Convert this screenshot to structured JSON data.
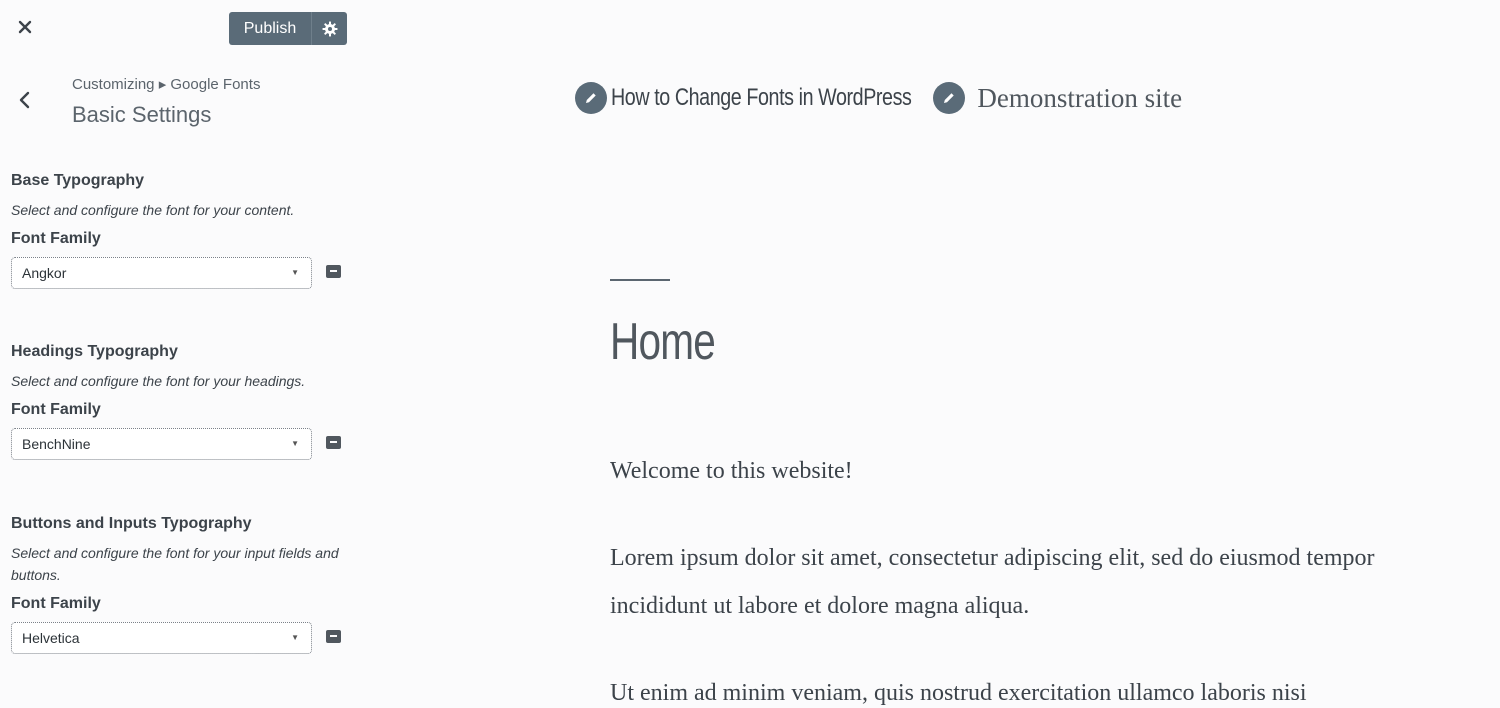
{
  "topbar": {
    "publish_label": "Publish"
  },
  "panel": {
    "breadcrumb": "Customizing ▸ Google Fonts",
    "title": "Basic Settings"
  },
  "sections": [
    {
      "title": "Base Typography",
      "description": "Select and configure the font for your content.",
      "font_family_label": "Font Family",
      "selected_font": "Angkor"
    },
    {
      "title": "Headings Typography",
      "description": "Select and configure the font for your headings.",
      "font_family_label": "Font Family",
      "selected_font": "BenchNine"
    },
    {
      "title": "Buttons and Inputs Typography",
      "description": "Select and configure the font for your input fields and buttons.",
      "font_family_label": "Font Family",
      "selected_font": "Helvetica"
    }
  ],
  "preview": {
    "site_title": "How to Change Fonts in WordPress",
    "site_description": "Demonstration site",
    "page_heading": "Home",
    "paragraphs": [
      "Welcome to this website!",
      "Lorem ipsum dolor sit amet, consectetur adipiscing elit, sed do eiusmod tempor incididunt ut labore et dolore magna aliqua.",
      "Ut enim ad minim veniam, quis nostrud exercitation ullamco laboris nisi"
    ]
  },
  "icons": {
    "close": "close-icon",
    "settings": "gear-icon",
    "back": "chevron-left-icon",
    "font_preview": "font-icon",
    "edit": "pencil-icon"
  },
  "colors": {
    "accent": "#5a6b78",
    "background": "#fbfbfc",
    "text": "#3c434a"
  }
}
